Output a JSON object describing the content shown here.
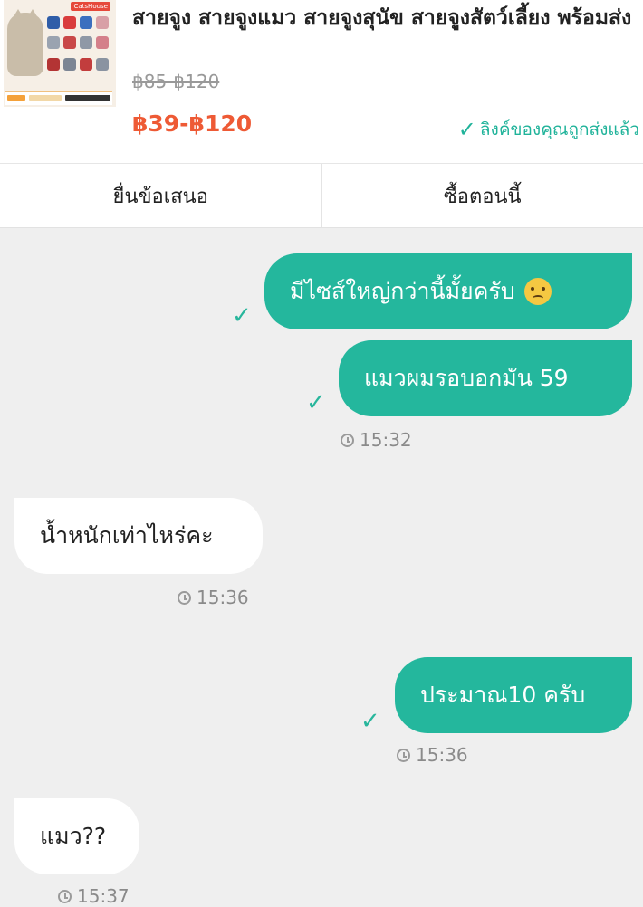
{
  "product": {
    "title": "สายจูง สายจูงแมว สายจูงสุนัข สายจูงสัตว์เลี้ยง พร้อมส่ง",
    "original_price": "฿85-฿120",
    "price": "฿39-฿120",
    "link_sent_text": "ลิงค์ของคุณถูกส่งแล้ว",
    "thumbnail_brand": "CatsHouse",
    "accent_color": "#ee5a35"
  },
  "actions": {
    "offer_label": "ยื่นข้อเสนอ",
    "buy_label": "ซื้อตอนนี้"
  },
  "messages": [
    {
      "side": "out",
      "text": "มีไซส์ใหญ่กว่านี้มั้ยครับ",
      "emoji": "crying-face-icon"
    },
    {
      "side": "out",
      "text": "แมวผมรอบอกมัน 59",
      "time": "15:32"
    },
    {
      "side": "in",
      "text": "น้ำหนักเท่าไหร่คะ",
      "time": "15:36"
    },
    {
      "side": "out",
      "text": "ประมาณ10 ครับ",
      "time": "15:36"
    },
    {
      "side": "in",
      "text": "แมว??",
      "time": "15:37"
    }
  ],
  "colors": {
    "outgoing_bubble": "#24b79d",
    "incoming_bubble": "#ffffff",
    "chat_background": "#efefef"
  }
}
